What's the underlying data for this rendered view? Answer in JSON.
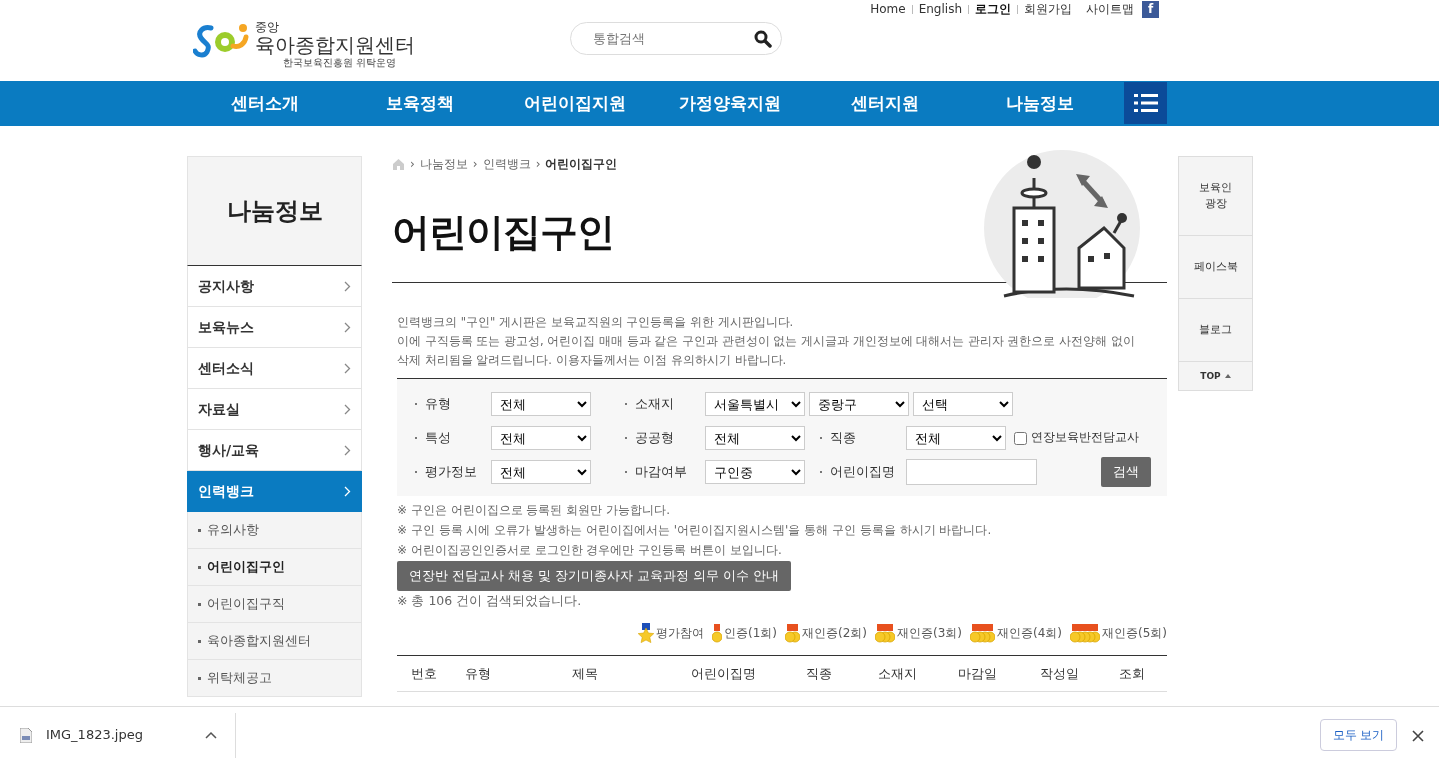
{
  "header": {
    "logo": {
      "top": "중앙",
      "main": "육아종합지원센터",
      "sub": "한국보육진흥원 위탁운영"
    },
    "search": {
      "placeholder": "통합검색"
    },
    "util_links": [
      {
        "label": "Home",
        "bold": false
      },
      {
        "label": "English",
        "bold": false
      },
      {
        "label": "로그인",
        "bold": true
      },
      {
        "label": "회원가입",
        "bold": false
      },
      {
        "label": "사이트맵",
        "bold": false
      }
    ],
    "facebook": "f"
  },
  "nav": [
    "센터소개",
    "보육정책",
    "어린이집지원",
    "가정양육지원",
    "센터지원",
    "나눔정보"
  ],
  "sidebar": {
    "title": "나눔정보",
    "items": [
      {
        "label": "공지사항",
        "selected": false
      },
      {
        "label": "보육뉴스",
        "selected": false
      },
      {
        "label": "센터소식",
        "selected": false
      },
      {
        "label": "자료실",
        "selected": false
      },
      {
        "label": "행사/교육",
        "selected": false
      },
      {
        "label": "인력뱅크",
        "selected": true,
        "children": [
          {
            "label": "유의사항",
            "selected": false
          },
          {
            "label": "어린이집구인",
            "selected": true
          },
          {
            "label": "어린이집구직",
            "selected": false
          },
          {
            "label": "육아종합지원센터",
            "selected": false
          },
          {
            "label": "위탁체공고",
            "selected": false
          }
        ]
      }
    ]
  },
  "breadcrumb": [
    "나눔정보",
    "인력뱅크",
    "어린이집구인"
  ],
  "breadcrumb_separator": "›",
  "page_title": "어린이집구인",
  "intro": [
    "인력뱅크의 \"구인\" 게시판은 보육교직원의 구인등록을 위한 게시판입니다.",
    "이에 구직등록 또는 광고성, 어린이집 매매 등과 같은 구인과 관련성이 없는 게시글과 개인정보에 대해서는 관리자 권한으로 사전양해 없이",
    "삭제 처리됨을 알려드립니다. 이용자들께서는 이점 유의하시기 바랍니다."
  ],
  "filters": [
    [
      {
        "label": "유형",
        "controls": [
          {
            "kind": "select",
            "value": "전체"
          }
        ]
      },
      {
        "label": "소재지",
        "controls": [
          {
            "kind": "select",
            "value": "서울특별시"
          },
          {
            "kind": "select",
            "value": "중랑구"
          },
          {
            "kind": "select",
            "value": "선택"
          }
        ]
      }
    ],
    [
      {
        "label": "특성",
        "controls": [
          {
            "kind": "select",
            "value": "전체"
          }
        ]
      },
      {
        "label": "공공형",
        "controls": [
          {
            "kind": "select",
            "value": "전체"
          }
        ]
      },
      {
        "label": "직종",
        "controls": [
          {
            "kind": "select",
            "value": "전체"
          },
          {
            "kind": "checkbox",
            "label": "연장보육반전담교사",
            "checked": false
          }
        ]
      }
    ],
    [
      {
        "label": "평가정보",
        "controls": [
          {
            "kind": "select",
            "value": "전체"
          }
        ]
      },
      {
        "label": "마감여부",
        "controls": [
          {
            "kind": "select",
            "value": "구인중"
          }
        ]
      },
      {
        "label": "어린이집명",
        "controls": [
          {
            "kind": "input"
          },
          {
            "kind": "button",
            "label": "검색"
          }
        ]
      }
    ]
  ],
  "notes": [
    "※ 구인은 어린이집으로 등록된 회원만 가능합니다.",
    "※ 구인 등록 시에 오류가 발생하는 어린이집에서는 '어린이집지원시스템'을 통해 구인 등록을 하시기 바랍니다.",
    "※ 어린이집공인인증서로 로그인한 경우에만 구인등록 버튼이 보입니다."
  ],
  "guide_button": "연장반 전담교사 채용 및 장기미종사자 교육과정 의무 이수 안내",
  "result_count": "※ 총 106 건이 검색되었습니다.",
  "legend": [
    {
      "kind": "star",
      "label": "평가참여"
    },
    {
      "kind": "medal",
      "label": "인증(1회)"
    },
    {
      "kind": "medal",
      "label": "재인증(2회)"
    },
    {
      "kind": "medal",
      "label": "재인증(3회)"
    },
    {
      "kind": "medal",
      "label": "재인증(4회)"
    },
    {
      "kind": "medal",
      "label": "재인증(5회)"
    }
  ],
  "table": {
    "columns": [
      "번호",
      "유형",
      "제목",
      "어린이집명",
      "직종",
      "소재지",
      "마감일",
      "작성일",
      "조회"
    ]
  },
  "quick_menu": [
    {
      "kind": "link",
      "label": "보육인\n광장"
    },
    {
      "kind": "link",
      "label": "페이스북"
    },
    {
      "kind": "link",
      "label": "블로그"
    },
    {
      "kind": "top",
      "label": "TOP"
    }
  ],
  "download_bar": {
    "file": "IMG_1823.jpeg",
    "show_all": "모두 보기"
  }
}
